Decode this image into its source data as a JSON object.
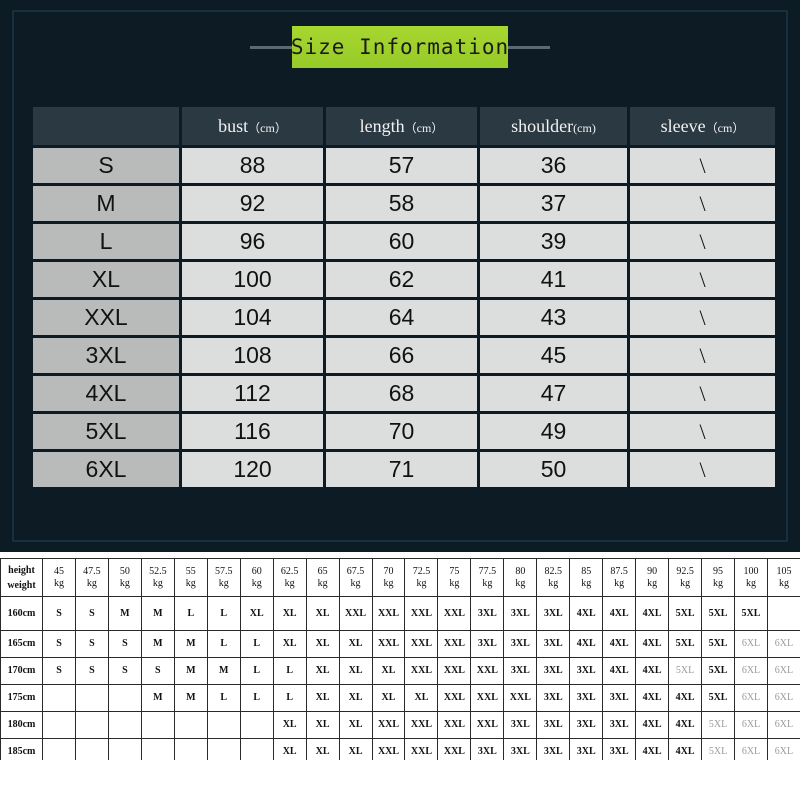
{
  "title": {
    "banner_text": "Size Information"
  },
  "size_table": {
    "corner_header": "",
    "headers": [
      {
        "label": "bust",
        "unit": "（cm）"
      },
      {
        "label": "length",
        "unit": "（cm）"
      },
      {
        "label": "shoulder",
        "unit": "(cm)"
      },
      {
        "label": "sleeve",
        "unit": "（cm）"
      }
    ],
    "rows": [
      {
        "size": "S",
        "bust": "88",
        "length": "57",
        "shoulder": "36",
        "sleeve": "\\"
      },
      {
        "size": "M",
        "bust": "92",
        "length": "58",
        "shoulder": "37",
        "sleeve": "\\"
      },
      {
        "size": "L",
        "bust": "96",
        "length": "60",
        "shoulder": "39",
        "sleeve": "\\"
      },
      {
        "size": "XL",
        "bust": "100",
        "length": "62",
        "shoulder": "41",
        "sleeve": "\\"
      },
      {
        "size": "XXL",
        "bust": "104",
        "length": "64",
        "shoulder": "43",
        "sleeve": "\\"
      },
      {
        "size": "3XL",
        "bust": "108",
        "length": "66",
        "shoulder": "45",
        "sleeve": "\\"
      },
      {
        "size": "4XL",
        "bust": "112",
        "length": "68",
        "shoulder": "47",
        "sleeve": "\\"
      },
      {
        "size": "5XL",
        "bust": "116",
        "length": "70",
        "shoulder": "49",
        "sleeve": "\\"
      },
      {
        "size": "6XL",
        "bust": "120",
        "length": "71",
        "shoulder": "50",
        "sleeve": "\\"
      }
    ]
  },
  "height_weight_table": {
    "corner_top": "height",
    "corner_bottom": "weight",
    "weight_unit": "kg",
    "weights": [
      "45",
      "47.5",
      "50",
      "52.5",
      "55",
      "57.5",
      "60",
      "62.5",
      "65",
      "67.5",
      "70",
      "72.5",
      "75",
      "77.5",
      "80",
      "82.5",
      "85",
      "87.5",
      "90",
      "92.5",
      "95",
      "100",
      "105"
    ],
    "rows": [
      {
        "height": "160cm",
        "sizes": [
          "S",
          "S",
          "M",
          "M",
          "L",
          "L",
          "XL",
          "XL",
          "XL",
          "XXL",
          "XXL",
          "XXL",
          "XXL",
          "3XL",
          "3XL",
          "3XL",
          "4XL",
          "4XL",
          "4XL",
          "5XL",
          "5XL",
          "5XL",
          "",
          ""
        ],
        "faint": []
      },
      {
        "height": "165cm",
        "sizes": [
          "S",
          "S",
          "S",
          "M",
          "M",
          "L",
          "L",
          "XL",
          "XL",
          "XL",
          "XXL",
          "XXL",
          "XXL",
          "3XL",
          "3XL",
          "3XL",
          "4XL",
          "4XL",
          "4XL",
          "5XL",
          "5XL",
          "6XL",
          "6XL"
        ],
        "faint": [
          21,
          22
        ]
      },
      {
        "height": "170cm",
        "sizes": [
          "S",
          "S",
          "S",
          "S",
          "M",
          "M",
          "L",
          "L",
          "XL",
          "XL",
          "XL",
          "XXL",
          "XXL",
          "XXL",
          "3XL",
          "3XL",
          "3XL",
          "4XL",
          "4XL",
          "5XL",
          "5XL",
          "6XL",
          "6XL"
        ],
        "faint": [
          19,
          21,
          22
        ]
      },
      {
        "height": "175cm",
        "sizes": [
          "",
          "",
          "",
          "M",
          "M",
          "L",
          "L",
          "L",
          "XL",
          "XL",
          "XL",
          "XL",
          "XXL",
          "XXL",
          "XXL",
          "3XL",
          "3XL",
          "3XL",
          "4XL",
          "4XL",
          "5XL",
          "6XL",
          "6XL"
        ],
        "faint": [
          21,
          22
        ]
      },
      {
        "height": "180cm",
        "sizes": [
          "",
          "",
          "",
          "",
          "",
          "",
          "",
          "XL",
          "XL",
          "XL",
          "XXL",
          "XXL",
          "XXL",
          "XXL",
          "3XL",
          "3XL",
          "3XL",
          "3XL",
          "4XL",
          "4XL",
          "5XL",
          "6XL",
          "6XL"
        ],
        "faint": [
          20,
          21,
          22
        ]
      },
      {
        "height": "185cm",
        "sizes": [
          "",
          "",
          "",
          "",
          "",
          "",
          "",
          "XL",
          "XL",
          "XL",
          "XXL",
          "XXL",
          "XXL",
          "3XL",
          "3XL",
          "3XL",
          "3XL",
          "3XL",
          "4XL",
          "4XL",
          "5XL",
          "6XL",
          "6XL"
        ],
        "faint": [
          20,
          21,
          22
        ]
      }
    ]
  },
  "colors": {
    "panel_bg": "#0d1b24",
    "banner_green": "#9acd32",
    "header_cell": "#2b3943",
    "size_label_cell": "#b9bbba",
    "value_cell": "#dcdedd"
  }
}
